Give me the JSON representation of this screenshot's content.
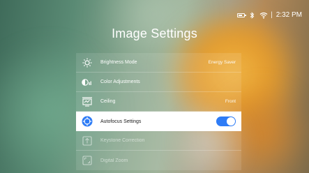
{
  "status_bar": {
    "battery_icon": "battery-icon",
    "bluetooth_icon": "bluetooth-icon",
    "wifi_icon": "wifi-icon",
    "separator": "|",
    "time": "2:32 PM"
  },
  "title": "Image Settings",
  "menu": {
    "items": [
      {
        "label": "Brightness Mode",
        "value": "Energy Saver",
        "icon": "brightness-icon"
      },
      {
        "label": "Color Adjustments",
        "value": "",
        "icon": "color-adjust-icon"
      },
      {
        "label": "Ceiling",
        "value": "Front",
        "icon": "projector-icon"
      },
      {
        "label": "Autofocus Settings",
        "value": "",
        "icon": "autofocus-icon",
        "toggle_on": true
      },
      {
        "label": "Keystone Correction",
        "value": "",
        "icon": "keystone-icon"
      },
      {
        "label": "Digital Zoom",
        "value": "",
        "icon": "zoom-icon"
      }
    ]
  },
  "colors": {
    "accent": "#2e7cf6",
    "selected_bg": "#ffffff"
  }
}
